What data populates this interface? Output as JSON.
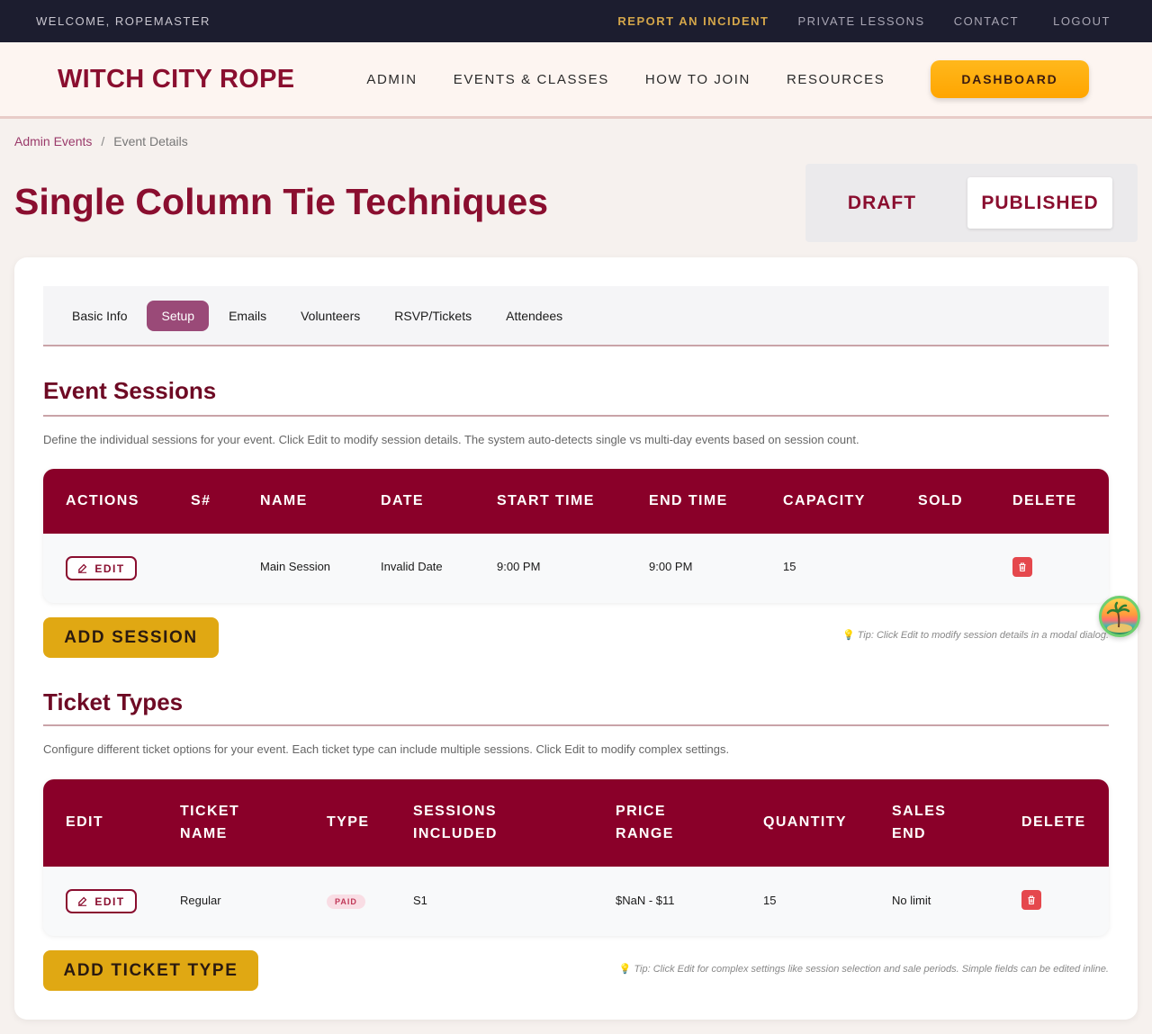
{
  "utility": {
    "welcome": "WELCOME, ROPEMASTER",
    "links": [
      "REPORT AN INCIDENT",
      "PRIVATE LESSONS",
      "CONTACT",
      "LOGOUT"
    ]
  },
  "header": {
    "logo": "WITCH CITY ROPE",
    "nav": [
      "ADMIN",
      "EVENTS & CLASSES",
      "HOW TO JOIN",
      "RESOURCES"
    ],
    "dashboard": "DASHBOARD"
  },
  "breadcrumb": {
    "link": "Admin Events",
    "separator": "/",
    "current": "Event Details"
  },
  "page": {
    "title": "Single Column Tie Techniques"
  },
  "status": {
    "draft": "DRAFT",
    "published": "PUBLISHED",
    "selected": "PUBLISHED"
  },
  "tabs": [
    "Basic Info",
    "Setup",
    "Emails",
    "Volunteers",
    "RSVP/Tickets",
    "Attendees"
  ],
  "active_tab": "Setup",
  "sessions": {
    "title": "Event Sessions",
    "description": "Define the individual sessions for your event. Click Edit to modify session details. The system auto-detects single vs multi-day events based on session count.",
    "headers": [
      "ACTIONS",
      "S#",
      "NAME",
      "DATE",
      "START TIME",
      "END TIME",
      "CAPACITY",
      "SOLD",
      "DELETE"
    ],
    "rows": [
      {
        "edit_label": "EDIT",
        "number": "",
        "name": "Main Session",
        "date": "Invalid Date",
        "start": "9:00 PM",
        "end": "9:00 PM",
        "capacity": "15",
        "sold": ""
      }
    ],
    "add_label": "ADD SESSION",
    "tip": "Tip: Click Edit to modify session details in a modal dialog."
  },
  "tickets": {
    "title": "Ticket Types",
    "description": "Configure different ticket options for your event. Each ticket type can include multiple sessions. Click Edit to modify complex settings.",
    "headers": {
      "edit": "EDIT",
      "name_1": "TICKET",
      "name_2": "NAME",
      "type": "TYPE",
      "sessions_1": "SESSIONS",
      "sessions_2": "INCLUDED",
      "price_1": "PRICE",
      "price_2": "RANGE",
      "quantity": "QUANTITY",
      "sales_1": "SALES",
      "sales_2": "END",
      "delete": "DELETE"
    },
    "rows": [
      {
        "edit_label": "EDIT",
        "name": "Regular",
        "type": "PAID",
        "sessions": "S1",
        "price": "$NaN - $11",
        "quantity": "15",
        "sales_end": "No limit"
      }
    ],
    "add_label": "ADD TICKET TYPE",
    "tip": "Tip: Click Edit for complex settings like session selection and sale periods. Simple fields can be edited inline."
  },
  "colors": {
    "brand": "#8a0e2f",
    "table_header": "#8a0029",
    "gold": "#e0a813",
    "tab_active": "#9a4a78",
    "delete": "#e5484d"
  },
  "icons": [
    "edit-icon",
    "trash-icon",
    "lightbulb-icon",
    "avatar"
  ]
}
